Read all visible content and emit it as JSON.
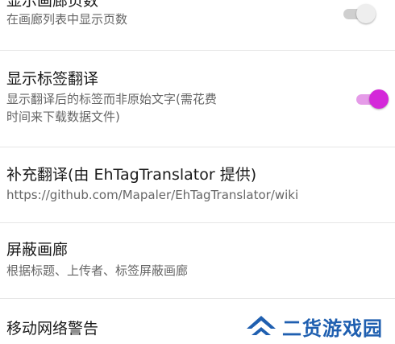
{
  "settings": {
    "items": [
      {
        "title": "显示画廊页数",
        "subtitle": "在画廊列表中显示页数",
        "toggle": "off"
      },
      {
        "title": "显示标签翻译",
        "subtitle_line1": "显示翻译后的标签而非原始文字(需花费",
        "subtitle_line2": "时间来下载数据文件)",
        "toggle": "on"
      },
      {
        "title": "补充翻译(由 EhTagTranslator 提供)",
        "subtitle": "https://github.com/Mapaler/EhTagTranslator/wiki"
      },
      {
        "title": "屏蔽画廊",
        "subtitle": "根据标题、上传者、标签屏蔽画廊"
      },
      {
        "title": "移动网络警告"
      }
    ]
  },
  "watermark": {
    "text": "二货游戏园",
    "icon": "double-chevron-logo"
  },
  "colors": {
    "accent": "#d428d9",
    "accent_track": "#e59be8",
    "switch_off_track": "#cfcfcf",
    "switch_off_thumb": "#eeeeee",
    "watermark_blue": "#1f5fb0"
  }
}
